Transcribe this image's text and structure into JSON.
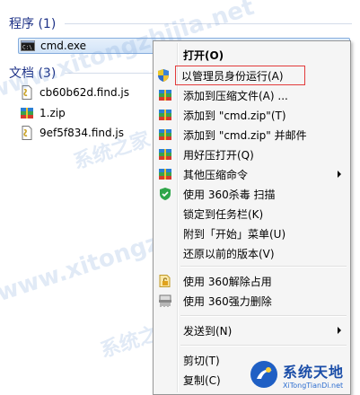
{
  "programs": {
    "header": "程序 (1)",
    "items": [
      {
        "name": "cmd.exe",
        "icon": "cmd-icon"
      }
    ]
  },
  "documents": {
    "header": "文档 (3)",
    "items": [
      {
        "name": "cb60b62d.find.js",
        "icon": "script-file-icon"
      },
      {
        "name": "1.zip",
        "icon": "zip-archive-icon"
      },
      {
        "name": "9ef5f834.find.js",
        "icon": "script-file-icon"
      }
    ]
  },
  "context_menu": {
    "items": [
      {
        "label": "打开(O)",
        "icon": "",
        "default": true
      },
      {
        "label": "以管理员身份运行(A)",
        "icon": "uac-shield-icon",
        "highlighted": true
      },
      {
        "label": "添加到压缩文件(A) ...",
        "icon": "archive-icon"
      },
      {
        "label": "添加到 \"cmd.zip\"(T)",
        "icon": "archive-icon"
      },
      {
        "label": "添加到 \"cmd.zip\" 并邮件",
        "icon": "archive-icon"
      },
      {
        "label": "用好压打开(Q)",
        "icon": "archive-icon"
      },
      {
        "label": "其他压缩命令",
        "icon": "archive-icon",
        "submenu": true
      },
      {
        "label": "使用 360杀毒 扫描",
        "icon": "360-shield-icon"
      },
      {
        "label": "锁定到任务栏(K)",
        "icon": ""
      },
      {
        "label": "附到「开始」菜单(U)",
        "icon": ""
      },
      {
        "label": "还原以前的版本(V)",
        "icon": ""
      },
      {
        "label": "使用 360解除占用",
        "icon": "unlock-file-icon"
      },
      {
        "label": "使用 360强力删除",
        "icon": "shredder-icon"
      },
      {
        "label": "发送到(N)",
        "icon": "",
        "submenu": true
      },
      {
        "label": "剪切(T)",
        "icon": ""
      },
      {
        "label": "复制(C)",
        "icon": ""
      }
    ]
  },
  "watermark": {
    "site": "www.xitongzhijia.net",
    "site_cn": "系统之家",
    "logo_name": "系统天地",
    "logo_url": "XiTongTianDi.net"
  },
  "colors": {
    "section_header": "#1e3287",
    "selection_border": "#84acdd",
    "highlight_outline": "#e23b3b",
    "menu_bg": "#f5f5f5"
  }
}
